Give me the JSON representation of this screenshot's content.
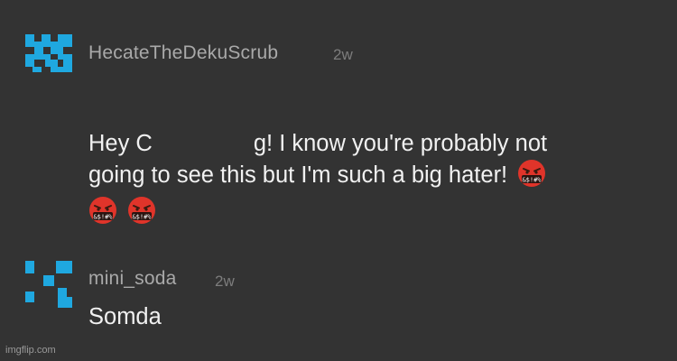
{
  "comments": [
    {
      "username": "HecateTheDekuScrub",
      "time": "2w",
      "text_line1_a": "Hey C",
      "text_line1_b": "g! I know you're probably not",
      "text_line2": "going to see this but I'm such a big hater!",
      "emoji": "face-with-symbols-on-mouth",
      "avatar_color": "#1fa8e0"
    },
    {
      "username": "mini_soda",
      "time": "2w",
      "text": "Somda",
      "avatar_color": "#1fa8e0"
    }
  ],
  "watermark": "imgflip.com",
  "colors": {
    "background": "#333333",
    "username": "#a9a9a9",
    "timestamp": "#7d7d7d",
    "body_text": "#f1f1f1"
  }
}
